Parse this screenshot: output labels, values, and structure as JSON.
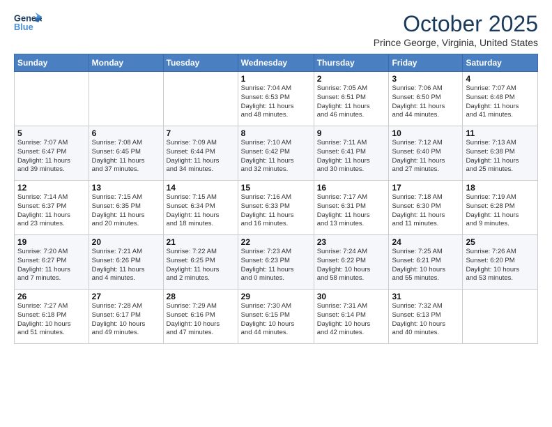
{
  "logo": {
    "text_general": "General",
    "text_blue": "Blue"
  },
  "header": {
    "month": "October 2025",
    "location": "Prince George, Virginia, United States"
  },
  "weekdays": [
    "Sunday",
    "Monday",
    "Tuesday",
    "Wednesday",
    "Thursday",
    "Friday",
    "Saturday"
  ],
  "weeks": [
    [
      {
        "day": "",
        "info": ""
      },
      {
        "day": "",
        "info": ""
      },
      {
        "day": "",
        "info": ""
      },
      {
        "day": "1",
        "info": "Sunrise: 7:04 AM\nSunset: 6:53 PM\nDaylight: 11 hours\nand 48 minutes."
      },
      {
        "day": "2",
        "info": "Sunrise: 7:05 AM\nSunset: 6:51 PM\nDaylight: 11 hours\nand 46 minutes."
      },
      {
        "day": "3",
        "info": "Sunrise: 7:06 AM\nSunset: 6:50 PM\nDaylight: 11 hours\nand 44 minutes."
      },
      {
        "day": "4",
        "info": "Sunrise: 7:07 AM\nSunset: 6:48 PM\nDaylight: 11 hours\nand 41 minutes."
      }
    ],
    [
      {
        "day": "5",
        "info": "Sunrise: 7:07 AM\nSunset: 6:47 PM\nDaylight: 11 hours\nand 39 minutes."
      },
      {
        "day": "6",
        "info": "Sunrise: 7:08 AM\nSunset: 6:45 PM\nDaylight: 11 hours\nand 37 minutes."
      },
      {
        "day": "7",
        "info": "Sunrise: 7:09 AM\nSunset: 6:44 PM\nDaylight: 11 hours\nand 34 minutes."
      },
      {
        "day": "8",
        "info": "Sunrise: 7:10 AM\nSunset: 6:42 PM\nDaylight: 11 hours\nand 32 minutes."
      },
      {
        "day": "9",
        "info": "Sunrise: 7:11 AM\nSunset: 6:41 PM\nDaylight: 11 hours\nand 30 minutes."
      },
      {
        "day": "10",
        "info": "Sunrise: 7:12 AM\nSunset: 6:40 PM\nDaylight: 11 hours\nand 27 minutes."
      },
      {
        "day": "11",
        "info": "Sunrise: 7:13 AM\nSunset: 6:38 PM\nDaylight: 11 hours\nand 25 minutes."
      }
    ],
    [
      {
        "day": "12",
        "info": "Sunrise: 7:14 AM\nSunset: 6:37 PM\nDaylight: 11 hours\nand 23 minutes."
      },
      {
        "day": "13",
        "info": "Sunrise: 7:15 AM\nSunset: 6:35 PM\nDaylight: 11 hours\nand 20 minutes."
      },
      {
        "day": "14",
        "info": "Sunrise: 7:15 AM\nSunset: 6:34 PM\nDaylight: 11 hours\nand 18 minutes."
      },
      {
        "day": "15",
        "info": "Sunrise: 7:16 AM\nSunset: 6:33 PM\nDaylight: 11 hours\nand 16 minutes."
      },
      {
        "day": "16",
        "info": "Sunrise: 7:17 AM\nSunset: 6:31 PM\nDaylight: 11 hours\nand 13 minutes."
      },
      {
        "day": "17",
        "info": "Sunrise: 7:18 AM\nSunset: 6:30 PM\nDaylight: 11 hours\nand 11 minutes."
      },
      {
        "day": "18",
        "info": "Sunrise: 7:19 AM\nSunset: 6:28 PM\nDaylight: 11 hours\nand 9 minutes."
      }
    ],
    [
      {
        "day": "19",
        "info": "Sunrise: 7:20 AM\nSunset: 6:27 PM\nDaylight: 11 hours\nand 7 minutes."
      },
      {
        "day": "20",
        "info": "Sunrise: 7:21 AM\nSunset: 6:26 PM\nDaylight: 11 hours\nand 4 minutes."
      },
      {
        "day": "21",
        "info": "Sunrise: 7:22 AM\nSunset: 6:25 PM\nDaylight: 11 hours\nand 2 minutes."
      },
      {
        "day": "22",
        "info": "Sunrise: 7:23 AM\nSunset: 6:23 PM\nDaylight: 11 hours\nand 0 minutes."
      },
      {
        "day": "23",
        "info": "Sunrise: 7:24 AM\nSunset: 6:22 PM\nDaylight: 10 hours\nand 58 minutes."
      },
      {
        "day": "24",
        "info": "Sunrise: 7:25 AM\nSunset: 6:21 PM\nDaylight: 10 hours\nand 55 minutes."
      },
      {
        "day": "25",
        "info": "Sunrise: 7:26 AM\nSunset: 6:20 PM\nDaylight: 10 hours\nand 53 minutes."
      }
    ],
    [
      {
        "day": "26",
        "info": "Sunrise: 7:27 AM\nSunset: 6:18 PM\nDaylight: 10 hours\nand 51 minutes."
      },
      {
        "day": "27",
        "info": "Sunrise: 7:28 AM\nSunset: 6:17 PM\nDaylight: 10 hours\nand 49 minutes."
      },
      {
        "day": "28",
        "info": "Sunrise: 7:29 AM\nSunset: 6:16 PM\nDaylight: 10 hours\nand 47 minutes."
      },
      {
        "day": "29",
        "info": "Sunrise: 7:30 AM\nSunset: 6:15 PM\nDaylight: 10 hours\nand 44 minutes."
      },
      {
        "day": "30",
        "info": "Sunrise: 7:31 AM\nSunset: 6:14 PM\nDaylight: 10 hours\nand 42 minutes."
      },
      {
        "day": "31",
        "info": "Sunrise: 7:32 AM\nSunset: 6:13 PM\nDaylight: 10 hours\nand 40 minutes."
      },
      {
        "day": "",
        "info": ""
      }
    ]
  ]
}
